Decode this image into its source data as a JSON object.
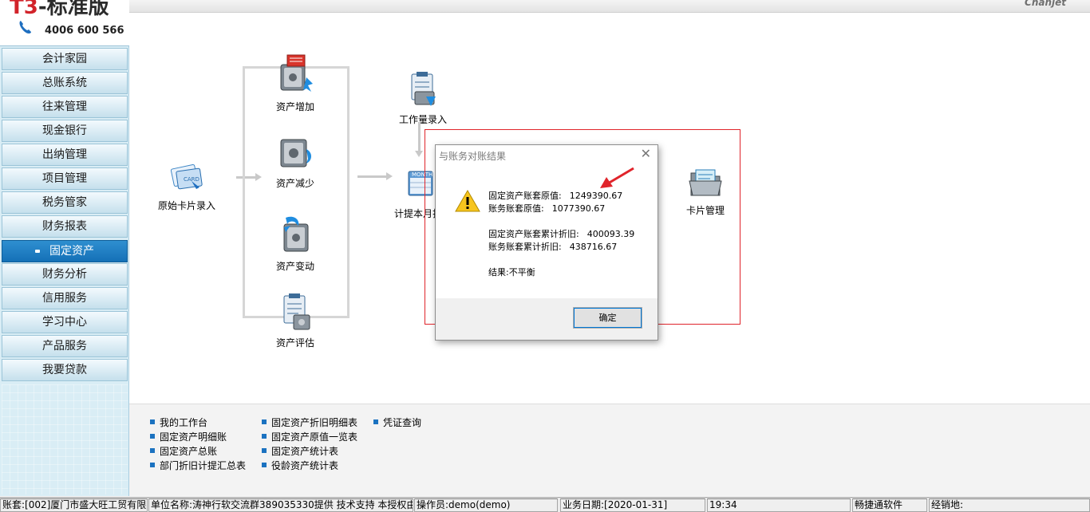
{
  "app": {
    "brand_prefix": "T3",
    "brand_suffix": "-标准版",
    "phone": "4006 600 566",
    "vendor": "Chanjet"
  },
  "sidebar": {
    "items": [
      {
        "label": "会计家园"
      },
      {
        "label": "总账系统"
      },
      {
        "label": "往来管理"
      },
      {
        "label": "现金银行"
      },
      {
        "label": "出纳管理"
      },
      {
        "label": "项目管理"
      },
      {
        "label": "税务管家"
      },
      {
        "label": "财务报表"
      },
      {
        "label": "固定资产",
        "active": true
      },
      {
        "label": "财务分析"
      },
      {
        "label": "信用服务"
      },
      {
        "label": "学习中心"
      },
      {
        "label": "产品服务"
      },
      {
        "label": "我要贷款"
      }
    ]
  },
  "flow": {
    "original_card": "原始卡片录入",
    "asset_add": "资产增加",
    "asset_reduce": "资产减少",
    "asset_change": "资产变动",
    "asset_evaluate": "资产评估",
    "workload_input": "工作量录入",
    "depreciation": "计提本月折",
    "card_manage": "卡片管理"
  },
  "dialog": {
    "title": "与账务对账结果",
    "fa_original_label": "固定资产账套原值:",
    "fa_original_value": "1249390.67",
    "gl_original_label": "账务账套原值:",
    "gl_original_value": "1077390.67",
    "fa_depr_label": "固定资产账套累计折旧:",
    "fa_depr_value": "400093.39",
    "gl_depr_label": "账务账套累计折旧:",
    "gl_depr_value": "438716.67",
    "result": "结果:不平衡",
    "ok_label": "确定"
  },
  "links": {
    "col1": [
      "我的工作台",
      "固定资产明细账",
      "固定资产总账",
      "部门折旧计提汇总表"
    ],
    "col2": [
      "固定资产折旧明细表",
      "固定资产原值一览表",
      "固定资产统计表",
      "役龄资产统计表"
    ],
    "col3": [
      "凭证查询"
    ]
  },
  "status": {
    "account": "账套:[002]厦门市盛大旺工贸有限",
    "unit": "单位名称:涛神行软交流群389035330提供 技术支持 本授权由:",
    "operator": "操作员:demo(demo)",
    "business_date": "业务日期:[2020-01-31]",
    "time": "19:34",
    "vendor": "畅捷通软件",
    "dealer": "经销地:"
  },
  "colors": {
    "accent": "#1470b7",
    "highlight_box": "#e0242b"
  }
}
